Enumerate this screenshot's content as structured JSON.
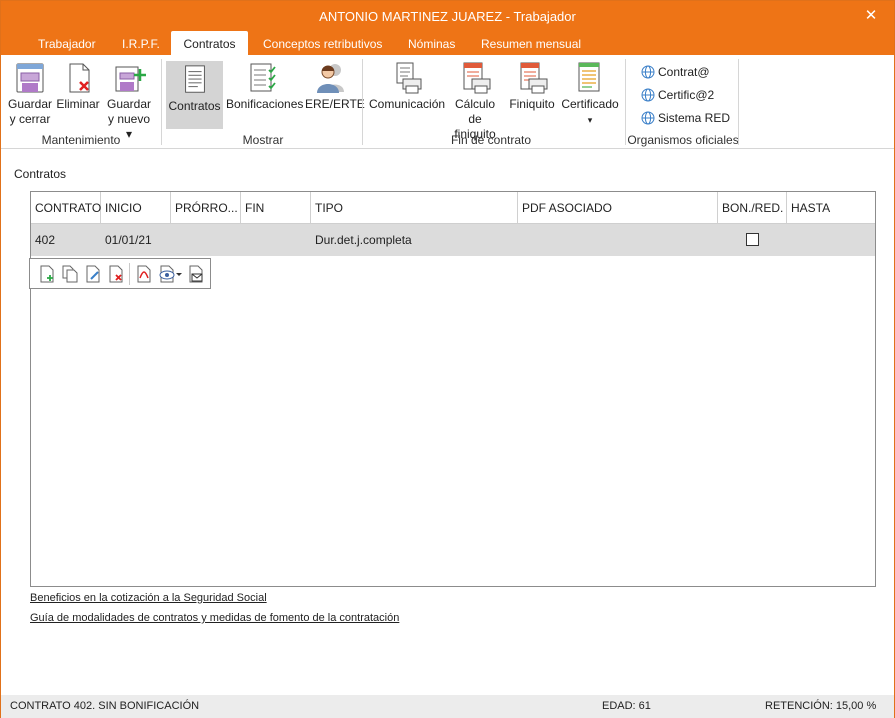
{
  "window": {
    "title": "ANTONIO MARTINEZ JUAREZ - Trabajador",
    "close": "✕"
  },
  "tabs": [
    {
      "label": "Trabajador"
    },
    {
      "label": "I.R.P.F."
    },
    {
      "label": "Contratos",
      "active": true
    },
    {
      "label": "Conceptos retributivos"
    },
    {
      "label": "Nóminas"
    },
    {
      "label": "Resumen mensual"
    }
  ],
  "ribbon": {
    "mantenimiento": {
      "label": "Mantenimiento",
      "guardar_cerrar": [
        "Guardar",
        "y cerrar"
      ],
      "eliminar": "Eliminar",
      "guardar_nuevo": [
        "Guardar",
        "y nuevo ▾"
      ]
    },
    "mostrar": {
      "label": "Mostrar",
      "contratos": "Contratos",
      "bonificaciones": "Bonificaciones",
      "ere": "ERE/ERTE"
    },
    "fin_contrato": {
      "label": "Fin de contrato",
      "comunicacion": "Comunicación",
      "calculo": [
        "Cálculo de",
        "finiquito"
      ],
      "finiquito": "Finiquito",
      "certificado": "Certificado",
      "certificado_arrow": "▾"
    },
    "organismos": {
      "label": "Organismos oficiales",
      "items": [
        "Contrat@",
        "Certific@2",
        "Sistema RED"
      ]
    }
  },
  "section_title": "Contratos",
  "grid": {
    "columns": [
      "CONTRATO",
      "INICIO",
      "PRÓRRO...",
      "FIN",
      "TIPO",
      "PDF ASOCIADO",
      "BON./RED.",
      "HASTA"
    ],
    "rows": [
      {
        "contrato": "402",
        "inicio": "01/01/21",
        "prorroga": "",
        "fin": "",
        "tipo": "Dur.det.j.completa",
        "pdf": "",
        "bon_red": false,
        "hasta": ""
      }
    ]
  },
  "links": [
    "Beneficios en la cotización a la Seguridad Social",
    "Guía de modalidades de contratos y medidas de fomento de la contratación"
  ],
  "status": {
    "contrato": "CONTRATO 402.  SIN BONIFICACIÓN",
    "edad": "EDAD: 61",
    "retencion": "RETENCIÓN: 15,00 %"
  },
  "colors": {
    "accent": "#ee7416"
  }
}
